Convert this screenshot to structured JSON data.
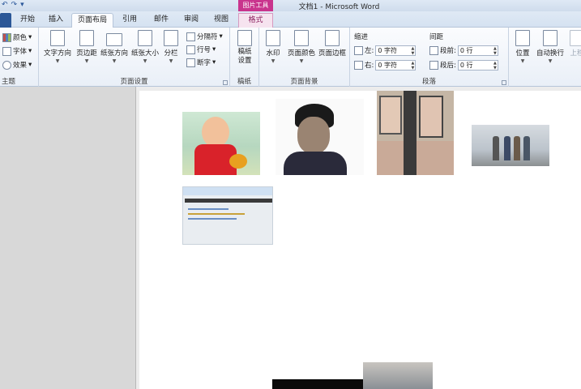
{
  "titlebar": {
    "title": "文档1 - Microsoft Word",
    "context_tool_group": "图片工具"
  },
  "tabs": [
    {
      "label": "开始"
    },
    {
      "label": "插入"
    },
    {
      "label": "页面布局"
    },
    {
      "label": "引用"
    },
    {
      "label": "邮件"
    },
    {
      "label": "审阅"
    },
    {
      "label": "视图"
    },
    {
      "label": "格式"
    }
  ],
  "ribbon": {
    "theme": {
      "colors": "颜色",
      "fonts": "字体",
      "effects": "效果",
      "label": "主题"
    },
    "page_setup": {
      "text_direction": "文字方向",
      "margins": "页边距",
      "orientation": "纸张方向",
      "size": "纸张大小",
      "columns": "分栏",
      "breaks": "分隔符",
      "line_numbers": "行号",
      "hyphenation": "断字",
      "label": "页面设置"
    },
    "draft": {
      "draft_settings": "稿纸设置",
      "label": "稿纸"
    },
    "page_background": {
      "watermark": "水印",
      "page_color": "页面颜色",
      "page_borders": "页面边框",
      "label": "页面背景"
    },
    "paragraph": {
      "indent_title": "缩进",
      "indent_left_label": "左:",
      "indent_left_value": "0 字符",
      "indent_right_label": "右:",
      "indent_right_value": "0 字符",
      "spacing_title": "间距",
      "spacing_before_label": "段前:",
      "spacing_before_value": "0 行",
      "spacing_after_label": "段后:",
      "spacing_after_value": "0 行",
      "label": "段落"
    },
    "arrange": {
      "position": "位置",
      "wrap_text": "自动换行",
      "bring_forward": "上移"
    }
  }
}
